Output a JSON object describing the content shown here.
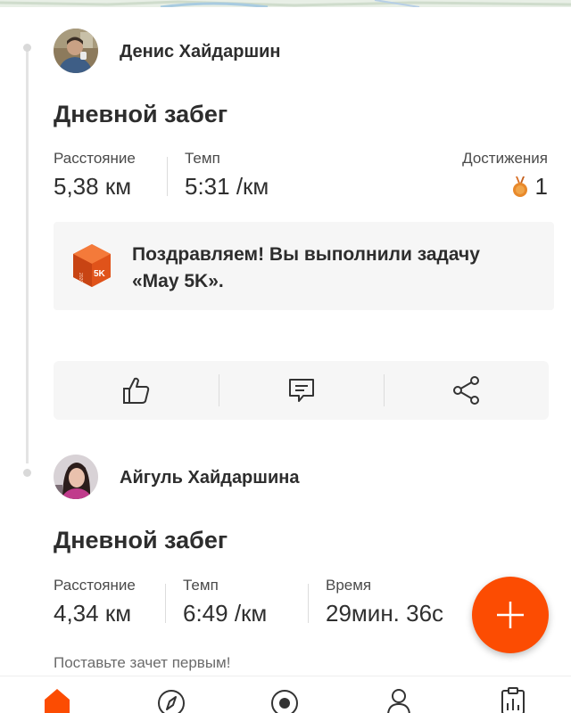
{
  "colors": {
    "accent": "#fc4c02",
    "background": "#ffffff",
    "card": "#f6f6f6",
    "text": "#2d2d2d",
    "muted": "#6b6b6b",
    "medal": "#e8892b"
  },
  "feed": [
    {
      "athlete": "Денис Хайдаршин",
      "avatar_icon": "user-photo-icon",
      "title": "Дневной забег",
      "stats": [
        {
          "label": "Расстояние",
          "value": "5,38 км"
        },
        {
          "label": "Темп",
          "value": "5:31 /км"
        }
      ],
      "achievements": {
        "label": "Достижения",
        "count": "1",
        "icon": "medal-icon"
      },
      "challenge": {
        "badge_text": "5K",
        "badge_icon": "challenge-badge-icon",
        "text": "Поздравляем! Вы выполнили задачу «May 5K»."
      },
      "actions": [
        {
          "name": "kudos-button",
          "icon": "thumbs-up-icon"
        },
        {
          "name": "comment-button",
          "icon": "comment-icon"
        },
        {
          "name": "share-button",
          "icon": "share-icon"
        }
      ]
    },
    {
      "athlete": "Айгуль Хайдаршина",
      "avatar_icon": "user-photo-icon",
      "title": "Дневной забег",
      "stats": [
        {
          "label": "Расстояние",
          "value": "4,34 км"
        },
        {
          "label": "Темп",
          "value": "6:49 /км"
        },
        {
          "label": "Время",
          "value": "29мин. 36с"
        }
      ],
      "cta": "Поставьте зачет первым!"
    }
  ],
  "fab": {
    "icon": "plus-icon"
  },
  "bottom_nav": [
    {
      "name": "home",
      "icon": "home-icon",
      "active": true
    },
    {
      "name": "explore",
      "icon": "compass-icon",
      "active": false
    },
    {
      "name": "record",
      "icon": "record-icon",
      "active": false
    },
    {
      "name": "profile",
      "icon": "profile-icon",
      "active": false
    },
    {
      "name": "training",
      "icon": "clipboard-icon",
      "active": false
    }
  ]
}
